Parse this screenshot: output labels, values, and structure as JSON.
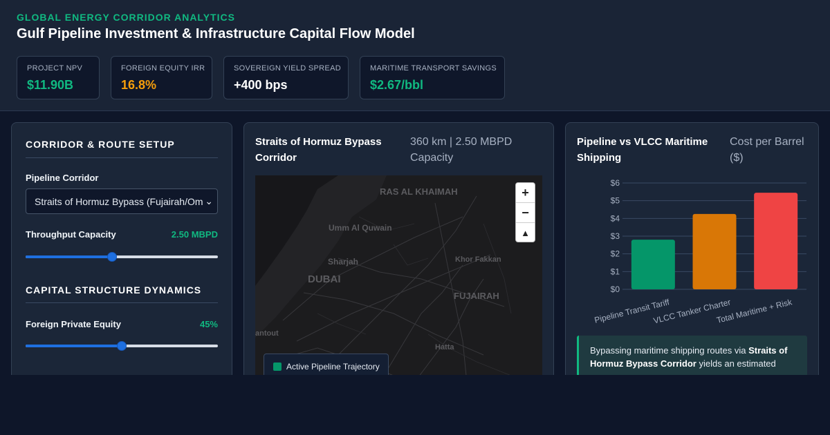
{
  "header": {
    "eyebrow": "GLOBAL ENERGY CORRIDOR ANALYTICS",
    "title": "Gulf Pipeline Investment & Infrastructure Capital Flow Model"
  },
  "kpis": [
    {
      "label": "PROJECT NPV",
      "value": "$11.90B",
      "color": "#10b981"
    },
    {
      "label": "FOREIGN EQUITY IRR",
      "value": "16.8%",
      "color": "#f59e0b"
    },
    {
      "label": "SOVEREIGN YIELD SPREAD",
      "value": "+400 bps",
      "color": "#ffffff"
    },
    {
      "label": "MARITIME TRANSPORT SAVINGS",
      "value": "$2.67/bbl",
      "color": "#10b981"
    }
  ],
  "setup": {
    "section1": "CORRIDOR & ROUTE SETUP",
    "corridor_label": "Pipeline Corridor",
    "corridor_value": "Straits of Hormuz Bypass (Fujairah/Om",
    "throughput_label": "Throughput Capacity",
    "throughput_value": "2.50 MBPD",
    "throughput_fraction": 0.45,
    "section2": "CAPITAL STRUCTURE DYNAMICS",
    "equity_label": "Foreign Private Equity",
    "equity_value": "45%",
    "equity_fraction": 0.5
  },
  "map_card": {
    "title": "Straits of Hormuz Bypass Corridor",
    "subtitle": "360 km | 2.50 MBPD Capacity",
    "places": [
      "RAS AL KHAIMAH",
      "Umm Al Quwain",
      "Sharjah",
      "DUBAI",
      "Khor Fakkan",
      "FUJAIRAH",
      "Hatta",
      "antout"
    ],
    "zoom_in": "+",
    "zoom_out": "−",
    "compass": "▲",
    "legend": "Active Pipeline Trajectory"
  },
  "cost_card": {
    "title": "Pipeline vs VLCC Maritime Shipping",
    "subtitle": "Cost per Barrel ($)",
    "insight_lead": "Bypassing maritime shipping routes via ",
    "insight_corridor": "Straits of Hormuz Bypass Corridor",
    "insight_tail": " yields an estimated"
  },
  "chart_data": {
    "type": "bar",
    "categories": [
      "Pipeline Transit Tariff",
      "VLCC Tanker Charter",
      "Total Maritime + Risk"
    ],
    "values": [
      2.8,
      4.25,
      5.45
    ],
    "colors": [
      "#059669",
      "#d97706",
      "#ef4444"
    ],
    "ylim": [
      0,
      6
    ],
    "yticks": [
      "$0",
      "$1",
      "$2",
      "$3",
      "$4",
      "$5",
      "$6"
    ],
    "grid": true
  }
}
